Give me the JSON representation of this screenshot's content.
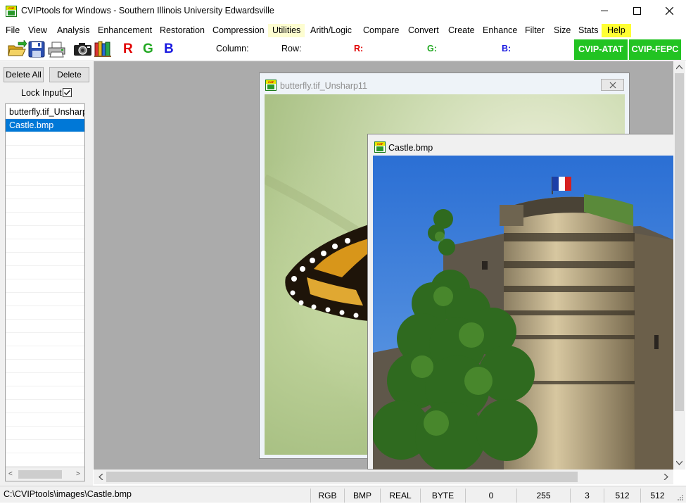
{
  "window": {
    "title": "CVIPtools for Windows - Southern Illinois University Edwardsville"
  },
  "menu": [
    "File",
    "View",
    "Analysis",
    "Enhancement",
    "Restoration",
    "Compression",
    "Utilities",
    "Arith/Logic",
    "Compare",
    "Convert",
    "Create",
    "Enhance",
    "Filter",
    "Size",
    "Stats",
    "Help"
  ],
  "toolbar": {
    "column_label": "Column:",
    "row_label": "Row:",
    "r_label": "R:",
    "g_label": "G:",
    "b_label": "B:",
    "r_btn": "R",
    "g_btn": "G",
    "b_btn": "B",
    "atat": "CVIP-ATAT",
    "fepc": "CVIP-FEPC",
    "icons": [
      "open-folder-icon",
      "save-icon",
      "print-icon",
      "camera-icon",
      "books-icon"
    ]
  },
  "left": {
    "delete_all": "Delete All",
    "delete": "Delete",
    "lock_input": "Lock Input",
    "lock_checked": true,
    "files": [
      "butterfly.tif_Unsharp11",
      "Castle.bmp"
    ],
    "selected": 1
  },
  "children": {
    "butterfly": {
      "title": "butterfly.tif_Unsharp11"
    },
    "castle": {
      "title": "Castle.bmp"
    }
  },
  "status": {
    "path": "C:\\CVIPtools\\images\\Castle.bmp",
    "color": "RGB",
    "format": "BMP",
    "dtype": "REAL",
    "dformat": "BYTE",
    "min": "0",
    "max": "255",
    "bands": "3",
    "width": "512",
    "height": "512"
  },
  "colors": {
    "red": "#e00000",
    "green": "#22a822",
    "blue": "#1a1ae0",
    "highlight_yellow": "#ffff33",
    "selection_blue": "#0078d7"
  }
}
